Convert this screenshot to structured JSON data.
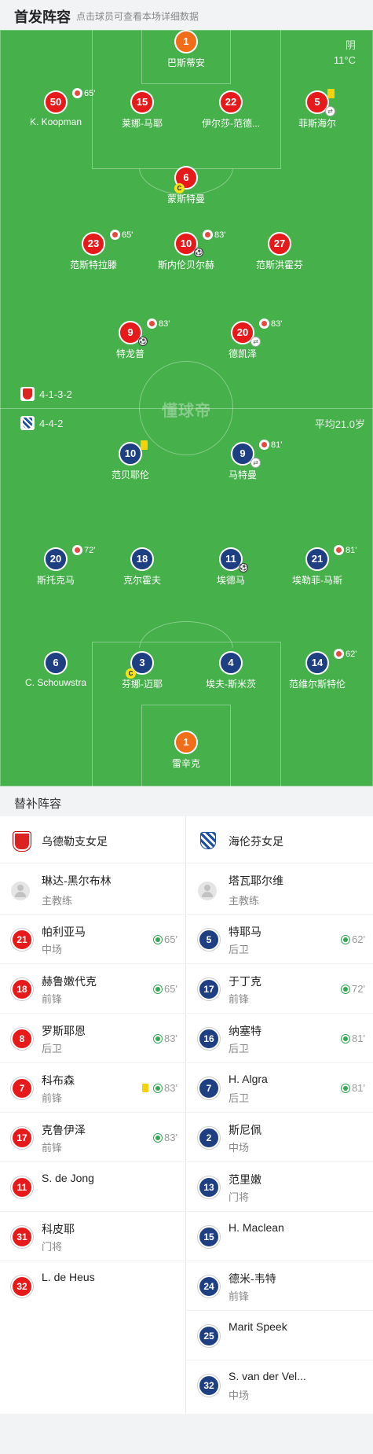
{
  "header": {
    "title": "首发阵容",
    "hint": "点击球员可查看本场详细数据"
  },
  "weather": {
    "condition": "阴",
    "temp": "11°C"
  },
  "watermark": "懂球帝",
  "home_formation": "4-1-3-2",
  "away_formation": "4-4-2",
  "avg_age": "平均21.0岁",
  "pitch_players": [
    {
      "num": "1",
      "name": "巴斯蒂安"
    },
    {
      "num": "50",
      "name": "K. Koopman",
      "sub": "65'"
    },
    {
      "num": "15",
      "name": "莱娜-马耶"
    },
    {
      "num": "22",
      "name": "伊尔莎-范德..."
    },
    {
      "num": "5",
      "name": "菲斯海尔"
    },
    {
      "num": "6",
      "name": "蒙斯特曼"
    },
    {
      "num": "23",
      "name": "范斯特拉滕",
      "sub": "65'"
    },
    {
      "num": "10",
      "name": "斯内伦贝尔赫",
      "sub": "83'"
    },
    {
      "num": "27",
      "name": "范斯洪霍芬"
    },
    {
      "num": "9",
      "name": "特龙普",
      "sub": "83'"
    },
    {
      "num": "20",
      "name": "德凯泽",
      "sub": "83'"
    },
    {
      "num": "10",
      "name": "范贝耶伦"
    },
    {
      "num": "9",
      "name": "马特曼",
      "sub": "81'"
    },
    {
      "num": "20",
      "name": "斯托克马",
      "sub": "72'"
    },
    {
      "num": "18",
      "name": "克尔霍夫"
    },
    {
      "num": "11",
      "name": "埃德马"
    },
    {
      "num": "21",
      "name": "埃勒菲-马斯",
      "sub": "81'"
    },
    {
      "num": "6",
      "name": "C. Schouwstra"
    },
    {
      "num": "3",
      "name": "芬娜-迈耶"
    },
    {
      "num": "4",
      "name": "埃夫-斯米茨"
    },
    {
      "num": "14",
      "name": "范维尔斯特伦",
      "sub": "62'"
    },
    {
      "num": "1",
      "name": "雷辛克"
    }
  ],
  "subs_title": "替补阵容",
  "home_team": {
    "name": "乌德勒支女足",
    "coach": {
      "name": "琳达-黑尔布林",
      "role": "主教练"
    },
    "subs": [
      {
        "num": "21",
        "name": "帕利亚马",
        "pos": "中场",
        "time": "65'"
      },
      {
        "num": "18",
        "name": "赫鲁嫩代克",
        "pos": "前锋",
        "time": "65'"
      },
      {
        "num": "8",
        "name": "罗斯耶恩",
        "pos": "后卫",
        "time": "83'"
      },
      {
        "num": "7",
        "name": "科布森",
        "pos": "前锋",
        "time": "83'"
      },
      {
        "num": "17",
        "name": "克鲁伊泽",
        "pos": "前锋",
        "time": "83'"
      },
      {
        "num": "11",
        "name": "S. de Jong",
        "pos": ""
      },
      {
        "num": "31",
        "name": "科皮耶",
        "pos": "门将"
      },
      {
        "num": "32",
        "name": "L. de Heus",
        "pos": ""
      }
    ]
  },
  "away_team": {
    "name": "海伦芬女足",
    "coach": {
      "name": "塔瓦耶尔维",
      "role": "主教练"
    },
    "subs": [
      {
        "num": "5",
        "name": "特耶马",
        "pos": "后卫",
        "time": "62'"
      },
      {
        "num": "17",
        "name": "于丁克",
        "pos": "前锋",
        "time": "72'"
      },
      {
        "num": "16",
        "name": "纳塞特",
        "pos": "后卫",
        "time": "81'"
      },
      {
        "num": "7",
        "name": "H. Algra",
        "pos": "后卫",
        "time": "81'"
      },
      {
        "num": "2",
        "name": "斯尼佩",
        "pos": "中场"
      },
      {
        "num": "13",
        "name": "范里嫩",
        "pos": "门将"
      },
      {
        "num": "15",
        "name": "H. Maclean",
        "pos": ""
      },
      {
        "num": "24",
        "name": "德米-韦特",
        "pos": "前锋"
      },
      {
        "num": "25",
        "name": "Marit Speek",
        "pos": ""
      },
      {
        "num": "32",
        "name": "S. van der Vel...",
        "pos": "中场"
      }
    ]
  }
}
